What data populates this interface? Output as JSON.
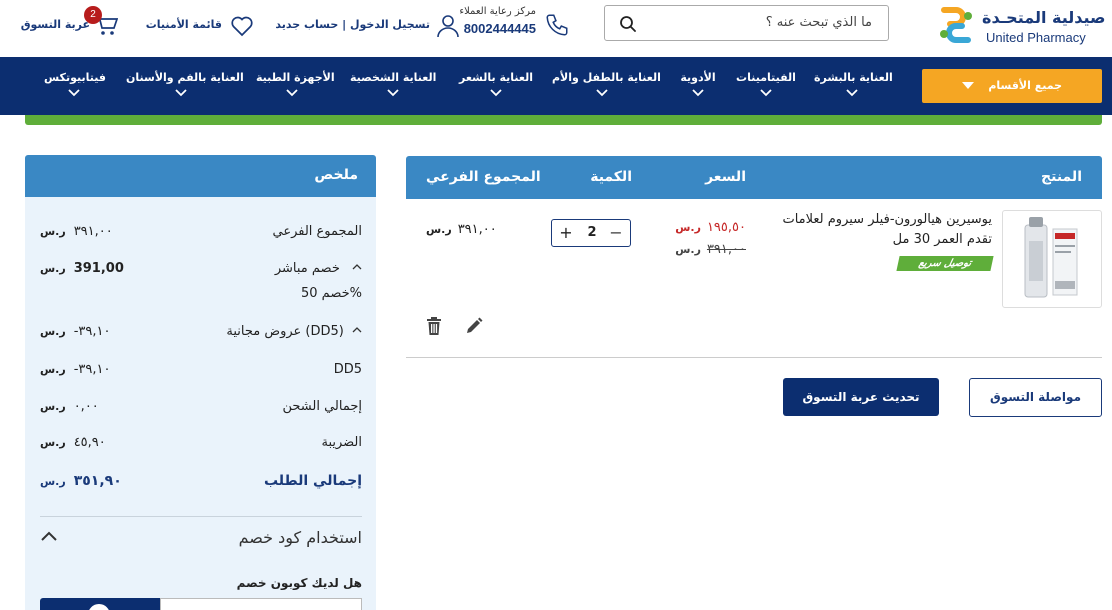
{
  "header": {
    "logo_ar": "صيدلية المتحـدة",
    "logo_en": "United Pharmacy",
    "search_placeholder": "ما الذي تبحث عنه ؟",
    "customer_care_label": "مركز رعاية العملاء",
    "customer_care_phone": "8002444445",
    "login_label": "تسجيل الدخول | حساب جديد",
    "wishlist_label": "قائمة الأمنيات",
    "cart_label": "عربة التسوق",
    "cart_count": "2"
  },
  "nav": {
    "all_categories": "جميع الأقسام",
    "items": [
      "العناية بالبشرة",
      "الفيتامينات",
      "الأدوية",
      "العناية بالطفل والأم",
      "العناية بالشعر",
      "العناية الشخصية",
      "الأجهزة الطبية",
      "العناية بالفم والأسنان",
      "فيتابيوتكس"
    ]
  },
  "cart": {
    "columns": {
      "product": "المنتج",
      "price": "السعر",
      "quantity": "الكمية",
      "subtotal": "المجموع الفرعي"
    },
    "item": {
      "name": "يوسيرين هيالورون-فيلر سيروم لعلامات تقدم العمر 30 مل",
      "badge": "توصيل سريع",
      "price_new": "١٩٥,٥٠",
      "price_old": "٣٩١,٠٠",
      "quantity": "2",
      "subtotal": "٣٩١,٠٠",
      "currency": "ر.س"
    },
    "continue_shopping": "مواصلة التسوق",
    "update_cart": "تحديث عربة التسوق"
  },
  "summary": {
    "title": "ملخص",
    "rows": [
      {
        "label": "المجموع الفرعي",
        "value": "٣٩١,٠٠"
      },
      {
        "label": "خصم مباشر",
        "value": "391,00"
      },
      {
        "label": "عروض مجانية (DD5)",
        "value": "-٣٩,١٠"
      },
      {
        "label": "DD5",
        "value": "-٣٩,١٠"
      },
      {
        "label": "إجمالي الشحن",
        "value": "٠,٠٠"
      },
      {
        "label": "الضريبة",
        "value": "٤٥,٩٠"
      },
      {
        "label": "إجمالي الطلب",
        "value": "٣٥١,٩٠"
      }
    ],
    "discount_note": "خصم 50%",
    "coupon_title": "استخدام كود خصم",
    "coupon_question": "هل لديك كوبون خصم",
    "currency": "ر.س"
  },
  "colors": {
    "navy": "#0c2e70",
    "orange": "#f5a623",
    "blue_header": "#3a88c4",
    "green": "#5fae3a",
    "summary_bg": "#eaf3fb",
    "price_red": "#c62828"
  }
}
